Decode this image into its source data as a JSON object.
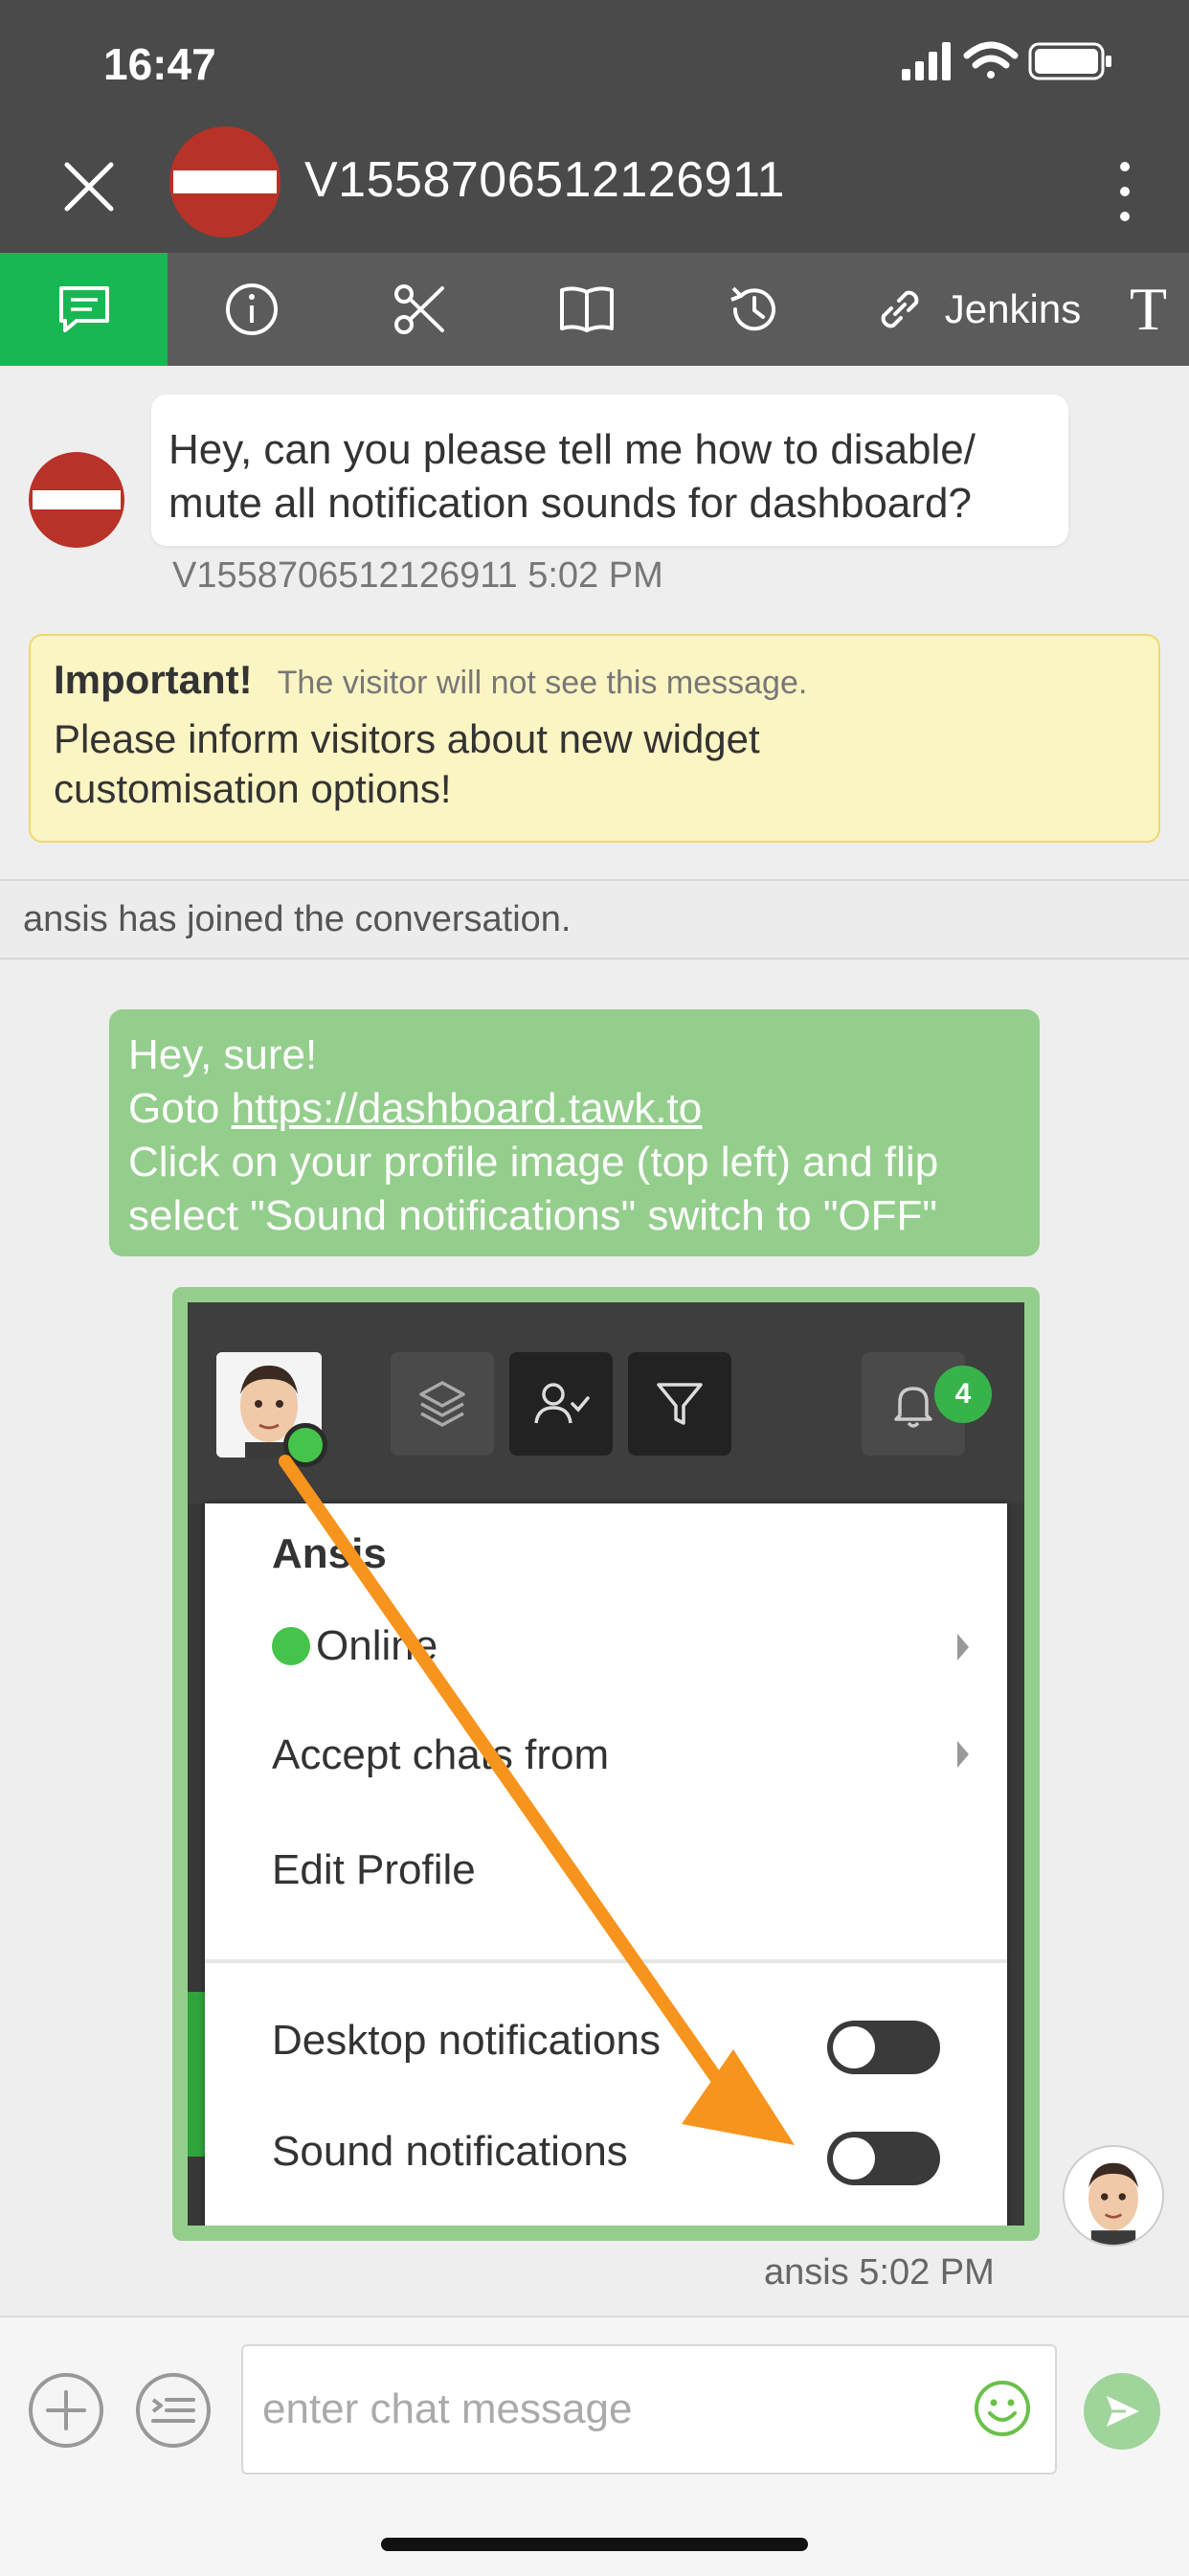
{
  "status_bar": {
    "time": "16:47"
  },
  "header": {
    "title": "V1558706512126911",
    "close_icon": "close-icon",
    "more_icon": "more-vertical-icon"
  },
  "tabs": [
    {
      "icon": "chat-icon",
      "active": true
    },
    {
      "icon": "info-icon"
    },
    {
      "icon": "scissors-icon"
    },
    {
      "icon": "book-icon"
    },
    {
      "icon": "history-icon"
    },
    {
      "icon": "link-icon",
      "label": "Jenkins"
    },
    {
      "label": "T"
    }
  ],
  "visitor_message": {
    "text_line1": "Hey, can you please tell me how to disable/",
    "text_line2": "mute all notification sounds for dashboard?",
    "meta": "V1558706512126911 5:02 PM"
  },
  "note": {
    "title": "Important!",
    "subtitle": "The visitor will not see this message.",
    "body_line1": "Please inform visitors about new widget",
    "body_line2": "customisation options!"
  },
  "system_message": "ansis has joined the conversation.",
  "agent_message": {
    "line1": "Hey, sure!",
    "goto_prefix": "Goto ",
    "link": "https://dashboard.tawk.to",
    "line3": "Click on your profile image (top left) and flip",
    "line4": "select \"Sound notifications\" switch to \"OFF\""
  },
  "screenshot": {
    "badge_count": "4",
    "menu": {
      "name": "Ansis",
      "status": "Online",
      "accept_chats": "Accept chats from",
      "edit_profile": "Edit Profile",
      "desktop_notifications": "Desktop notifications",
      "sound_notifications": "Sound notifications"
    }
  },
  "agent_meta": "ansis 5:02 PM",
  "composer": {
    "placeholder": "enter chat message"
  },
  "colors": {
    "header_bg": "#4a4a4a",
    "tab_active": "#17b853",
    "agent_bubble": "#94ce8c",
    "note_bg": "#fbf4c3",
    "arrow": "#f7941d"
  }
}
